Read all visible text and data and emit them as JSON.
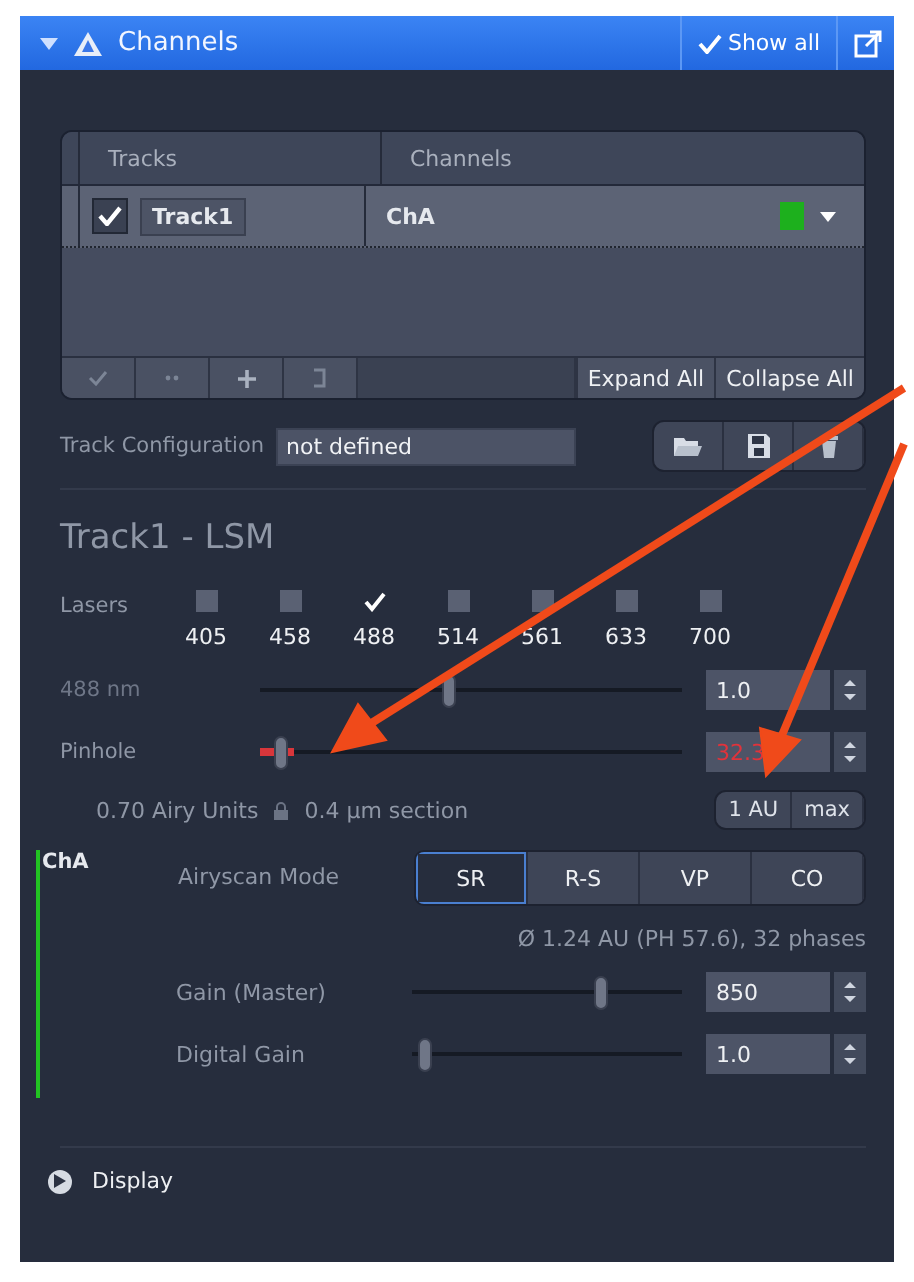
{
  "panel": {
    "title": "Channels",
    "expanded": true,
    "show_all": {
      "label": "Show all",
      "checked": true
    }
  },
  "tracks_table": {
    "columns": [
      "Tracks",
      "Channels"
    ],
    "rows": [
      {
        "track": "Track1",
        "checked": true,
        "channel": "ChA",
        "color": "#1db01d"
      }
    ],
    "buttons": [
      "Expand All",
      "Collapse All"
    ]
  },
  "track_configuration": {
    "label": "Track Configuration",
    "value": "not defined"
  },
  "track_title": "Track1 - LSM",
  "lasers": {
    "label": "Lasers",
    "items": [
      {
        "wavelength": "405",
        "checked": false
      },
      {
        "wavelength": "458",
        "checked": false
      },
      {
        "wavelength": "488",
        "checked": true
      },
      {
        "wavelength": "514",
        "checked": false
      },
      {
        "wavelength": "561",
        "checked": false
      },
      {
        "wavelength": "633",
        "checked": false
      },
      {
        "wavelength": "700",
        "checked": false
      }
    ]
  },
  "sliders": [
    {
      "label": "488 nm",
      "level": 0.45,
      "value": "1.0",
      "warning": false
    },
    {
      "label": "Pinhole",
      "level": 0.05,
      "value": "32.3",
      "warning": true
    }
  ],
  "pinhole_info": {
    "airy": "0.70 Airy Units",
    "section": "0.4 µm section",
    "buttons": [
      "1 AU",
      "max"
    ]
  },
  "channel": {
    "name": "ChA",
    "color": "#22c322",
    "mode_label": "Airyscan Mode",
    "modes": [
      {
        "label": "SR",
        "selected": true
      },
      {
        "label": "R-S",
        "selected": false
      },
      {
        "label": "VP",
        "selected": false
      },
      {
        "label": "CO",
        "selected": false
      }
    ],
    "info": "Ø 1.24 AU (PH 57.6), 32 phases",
    "sliders": [
      {
        "label": "Gain (Master)",
        "level": 0.7,
        "value": "850"
      },
      {
        "label": "Digital Gain",
        "level": 0.05,
        "value": "1.0"
      }
    ]
  },
  "display": {
    "label": "Display",
    "expanded": false
  }
}
